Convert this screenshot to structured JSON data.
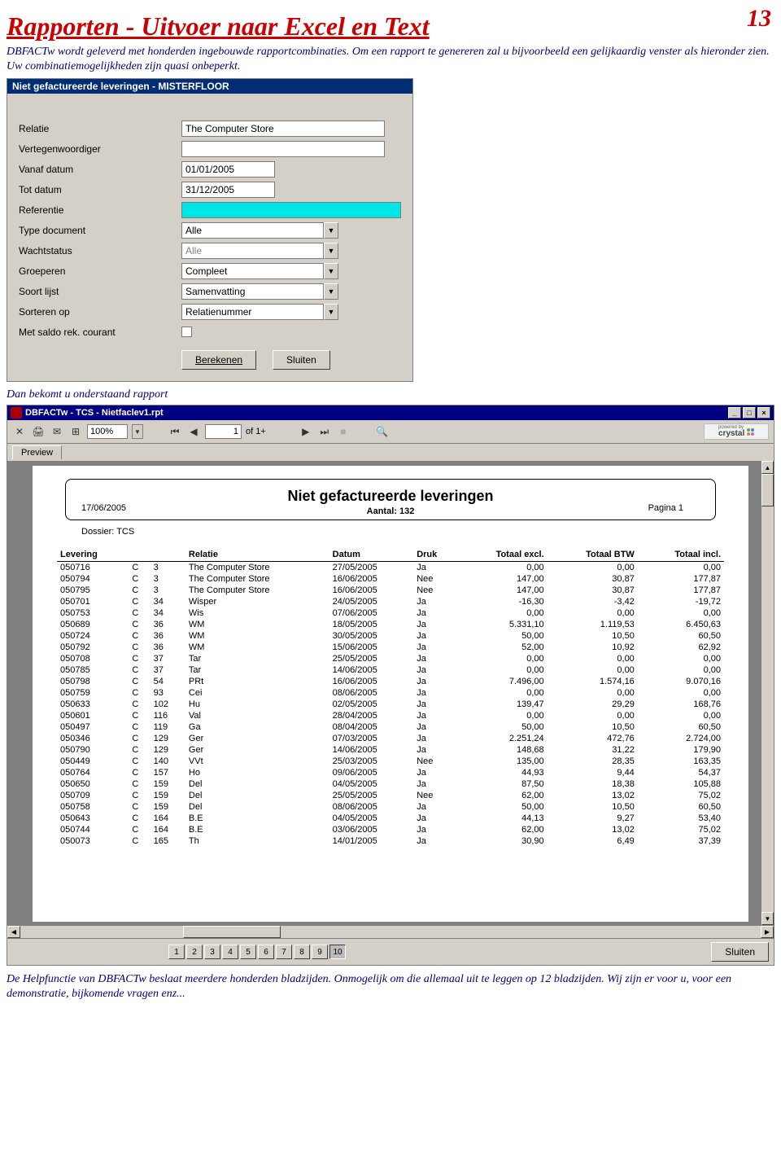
{
  "page_number": "13",
  "title": "Rapporten - Uitvoer naar Excel en Text",
  "intro": "DBFACTw wordt geleverd met honderden ingebouwde rapportcombinaties. Om een rapport te genereren zal u bijvoorbeeld een gelijkaardig venster als hieronder zien. Uw combinatiemogelijkheden zijn quasi onbeperkt.",
  "dialog": {
    "title": "Niet gefactureerde leveringen   -   MISTERFLOOR",
    "fields": {
      "relatie_label": "Relatie",
      "relatie_value": "The Computer Store",
      "vertegenwoordiger_label": "Vertegenwoordiger",
      "vertegenwoordiger_value": "",
      "vanaf_label": "Vanaf datum",
      "vanaf_value": "01/01/2005",
      "tot_label": "Tot datum",
      "tot_value": "31/12/2005",
      "referentie_label": "Referentie",
      "referentie_value": "",
      "typedoc_label": "Type document",
      "typedoc_value": "Alle",
      "wacht_label": "Wachtstatus",
      "wacht_value": "Alle",
      "groep_label": "Groeperen",
      "groep_value": "Compleet",
      "soort_label": "Soort lijst",
      "soort_value": "Samenvatting",
      "sort_label": "Sorteren op",
      "sort_value": "Relatienummer",
      "saldo_label": "Met saldo rek. courant"
    },
    "buttons": {
      "berekenen": "Berekenen",
      "sluiten": "Sluiten"
    }
  },
  "after_dialog": "Dan bekomt u onderstaand rapport",
  "report_window": {
    "title": "DBFACTw   -   TCS - Nietfaclev1.rpt",
    "zoom": "100%",
    "page_current": "1",
    "page_of": "of 1+",
    "tab": "Preview",
    "heading": "Niet gefactureerde leveringen",
    "date": "17/06/2005",
    "count_label": "Aantal: 132",
    "page_label": "Pagina   1",
    "dossier": "Dossier: TCS",
    "columns": [
      "Levering",
      "",
      "",
      "Relatie",
      "Datum",
      "Druk",
      "Totaal excl.",
      "Totaal BTW",
      "Totaal incl."
    ],
    "rows": [
      [
        "050716",
        "C",
        "3",
        "The Computer Store",
        "27/05/2005",
        "Ja",
        "0,00",
        "0,00",
        "0,00"
      ],
      [
        "050794",
        "C",
        "3",
        "The Computer Store",
        "16/06/2005",
        "Nee",
        "147,00",
        "30,87",
        "177,87"
      ],
      [
        "050795",
        "C",
        "3",
        "The Computer Store",
        "16/06/2005",
        "Nee",
        "147,00",
        "30,87",
        "177,87"
      ],
      [
        "050701",
        "C",
        "34",
        "Wisper",
        "24/05/2005",
        "Ja",
        "-16,30",
        "-3,42",
        "-19,72"
      ],
      [
        "050753",
        "C",
        "34",
        "Wis",
        "07/06/2005",
        "Ja",
        "0,00",
        "0,00",
        "0,00"
      ],
      [
        "050689",
        "C",
        "36",
        "WM",
        "18/05/2005",
        "Ja",
        "5.331,10",
        "1.119,53",
        "6.450,63"
      ],
      [
        "050724",
        "C",
        "36",
        "WM",
        "30/05/2005",
        "Ja",
        "50,00",
        "10,50",
        "60,50"
      ],
      [
        "050792",
        "C",
        "36",
        "WM",
        "15/06/2005",
        "Ja",
        "52,00",
        "10,92",
        "62,92"
      ],
      [
        "050708",
        "C",
        "37",
        "Tar",
        "25/05/2005",
        "Ja",
        "0,00",
        "0,00",
        "0,00"
      ],
      [
        "050785",
        "C",
        "37",
        "Tar",
        "14/06/2005",
        "Ja",
        "0,00",
        "0,00",
        "0,00"
      ],
      [
        "050798",
        "C",
        "54",
        "PRt",
        "16/06/2005",
        "Ja",
        "7.496,00",
        "1.574,16",
        "9.070,16"
      ],
      [
        "050759",
        "C",
        "93",
        "Cei",
        "08/06/2005",
        "Ja",
        "0,00",
        "0,00",
        "0,00"
      ],
      [
        "050633",
        "C",
        "102",
        "Hu",
        "02/05/2005",
        "Ja",
        "139,47",
        "29,29",
        "168,76"
      ],
      [
        "050601",
        "C",
        "116",
        "Val",
        "28/04/2005",
        "Ja",
        "0,00",
        "0,00",
        "0,00"
      ],
      [
        "050497",
        "C",
        "119",
        "Ga",
        "08/04/2005",
        "Ja",
        "50,00",
        "10,50",
        "60,50"
      ],
      [
        "050346",
        "C",
        "129",
        "Ger",
        "07/03/2005",
        "Ja",
        "2.251,24",
        "472,76",
        "2.724,00"
      ],
      [
        "050790",
        "C",
        "129",
        "Ger",
        "14/06/2005",
        "Ja",
        "148,68",
        "31,22",
        "179,90"
      ],
      [
        "050449",
        "C",
        "140",
        "VVt",
        "25/03/2005",
        "Nee",
        "135,00",
        "28,35",
        "163,35"
      ],
      [
        "050764",
        "C",
        "157",
        "Ho",
        "09/06/2005",
        "Ja",
        "44,93",
        "9,44",
        "54,37"
      ],
      [
        "050650",
        "C",
        "159",
        "Del",
        "04/05/2005",
        "Ja",
        "87,50",
        "18,38",
        "105,88"
      ],
      [
        "050709",
        "C",
        "159",
        "Del",
        "25/05/2005",
        "Nee",
        "62,00",
        "13,02",
        "75,02"
      ],
      [
        "050758",
        "C",
        "159",
        "Del",
        "08/06/2005",
        "Ja",
        "50,00",
        "10,50",
        "60,50"
      ],
      [
        "050643",
        "C",
        "164",
        "B.E",
        "04/05/2005",
        "Ja",
        "44,13",
        "9,27",
        "53,40"
      ],
      [
        "050744",
        "C",
        "164",
        "B.E",
        "03/06/2005",
        "Ja",
        "62,00",
        "13,02",
        "75,02"
      ],
      [
        "050073",
        "C",
        "165",
        "Th",
        "14/01/2005",
        "Ja",
        "30,90",
        "6,49",
        "37,39"
      ]
    ],
    "pager_pages": [
      "1",
      "2",
      "3",
      "4",
      "5",
      "6",
      "7",
      "8",
      "9",
      "10"
    ],
    "pager_active": 10,
    "sluiten": "Sluiten"
  },
  "footer": "De Helpfunctie van DBFACTw beslaat meerdere honderden bladzijden. Onmogelijk om die allemaal uit te leggen op 12 bladzijden. Wij zijn er voor u, voor een demonstratie, bijkomende vragen enz..."
}
